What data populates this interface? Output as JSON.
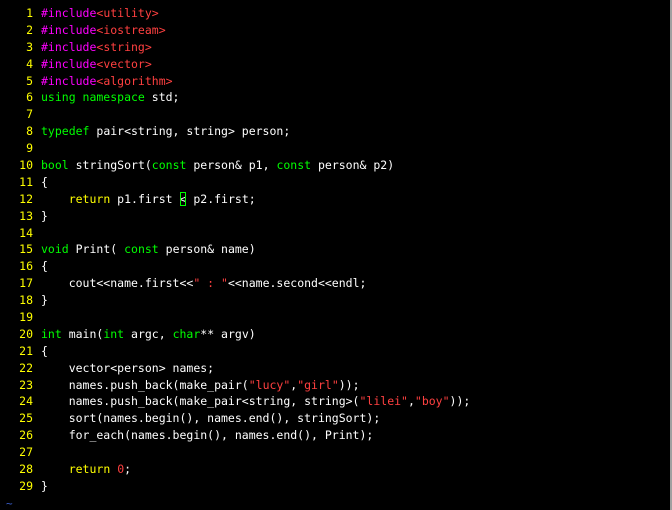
{
  "colors": {
    "background": "#000000",
    "line_number": "#ffff00",
    "plain": "#ffffff",
    "preproc": "#ff00ff",
    "string": "#ff4040",
    "keyword": "#ffff00",
    "type": "#00ff00",
    "cursor": "#00ff00",
    "tilde": "#3a5fcd"
  },
  "editor": {
    "lines": [
      {
        "n": "1",
        "tokens": [
          {
            "t": "#include",
            "c": "preproc"
          },
          {
            "t": "<utility>",
            "c": "string"
          }
        ]
      },
      {
        "n": "2",
        "tokens": [
          {
            "t": "#include",
            "c": "preproc"
          },
          {
            "t": "<iostream>",
            "c": "string"
          }
        ]
      },
      {
        "n": "3",
        "tokens": [
          {
            "t": "#include",
            "c": "preproc"
          },
          {
            "t": "<string>",
            "c": "string"
          }
        ]
      },
      {
        "n": "4",
        "tokens": [
          {
            "t": "#include",
            "c": "preproc"
          },
          {
            "t": "<vector>",
            "c": "string"
          }
        ]
      },
      {
        "n": "5",
        "tokens": [
          {
            "t": "#include",
            "c": "preproc"
          },
          {
            "t": "<algorithm>",
            "c": "string"
          }
        ]
      },
      {
        "n": "6",
        "tokens": [
          {
            "t": "using namespace",
            "c": "type"
          },
          {
            "t": " std;",
            "c": "plain"
          }
        ]
      },
      {
        "n": "7",
        "tokens": []
      },
      {
        "n": "8",
        "tokens": [
          {
            "t": "typedef",
            "c": "type"
          },
          {
            "t": " pair<string, string> person;",
            "c": "plain"
          }
        ]
      },
      {
        "n": "9",
        "tokens": []
      },
      {
        "n": "10",
        "tokens": [
          {
            "t": "bool",
            "c": "type"
          },
          {
            "t": " stringSort(",
            "c": "plain"
          },
          {
            "t": "const",
            "c": "type"
          },
          {
            "t": " person& p1, ",
            "c": "plain"
          },
          {
            "t": "const",
            "c": "type"
          },
          {
            "t": " person& p2)",
            "c": "plain"
          }
        ]
      },
      {
        "n": "11",
        "tokens": [
          {
            "t": "{",
            "c": "plain"
          }
        ]
      },
      {
        "n": "12",
        "tokens": [
          {
            "t": "    ",
            "c": "plain"
          },
          {
            "t": "return",
            "c": "keyword"
          },
          {
            "t": " p1.first ",
            "c": "plain"
          },
          {
            "t": "<",
            "c": "cursor"
          },
          {
            "t": " p2.first;",
            "c": "plain"
          }
        ]
      },
      {
        "n": "13",
        "tokens": [
          {
            "t": "}",
            "c": "plain"
          }
        ]
      },
      {
        "n": "14",
        "tokens": []
      },
      {
        "n": "15",
        "tokens": [
          {
            "t": "void",
            "c": "type"
          },
          {
            "t": " Print( ",
            "c": "plain"
          },
          {
            "t": "const",
            "c": "type"
          },
          {
            "t": " person& name)",
            "c": "plain"
          }
        ]
      },
      {
        "n": "16",
        "tokens": [
          {
            "t": "{",
            "c": "plain"
          }
        ]
      },
      {
        "n": "17",
        "tokens": [
          {
            "t": "    cout<<name.first<<",
            "c": "plain"
          },
          {
            "t": "\" : \"",
            "c": "string"
          },
          {
            "t": "<<name.second<<endl;",
            "c": "plain"
          }
        ]
      },
      {
        "n": "18",
        "tokens": [
          {
            "t": "}",
            "c": "plain"
          }
        ]
      },
      {
        "n": "19",
        "tokens": []
      },
      {
        "n": "20",
        "tokens": [
          {
            "t": "int",
            "c": "type"
          },
          {
            "t": " main(",
            "c": "plain"
          },
          {
            "t": "int",
            "c": "type"
          },
          {
            "t": " argc, ",
            "c": "plain"
          },
          {
            "t": "char",
            "c": "type"
          },
          {
            "t": "** argv)",
            "c": "plain"
          }
        ]
      },
      {
        "n": "21",
        "tokens": [
          {
            "t": "{",
            "c": "plain"
          }
        ]
      },
      {
        "n": "22",
        "tokens": [
          {
            "t": "    vector<person> names;",
            "c": "plain"
          }
        ]
      },
      {
        "n": "23",
        "tokens": [
          {
            "t": "    names.push_back(make_pair(",
            "c": "plain"
          },
          {
            "t": "\"lucy\"",
            "c": "string"
          },
          {
            "t": ",",
            "c": "plain"
          },
          {
            "t": "\"girl\"",
            "c": "string"
          },
          {
            "t": "));",
            "c": "plain"
          }
        ]
      },
      {
        "n": "24",
        "tokens": [
          {
            "t": "    names.push_back(make_pair<string, string>(",
            "c": "plain"
          },
          {
            "t": "\"lilei\"",
            "c": "string"
          },
          {
            "t": ",",
            "c": "plain"
          },
          {
            "t": "\"boy\"",
            "c": "string"
          },
          {
            "t": "));",
            "c": "plain"
          }
        ]
      },
      {
        "n": "25",
        "tokens": [
          {
            "t": "    sort(names.begin(), names.end(), stringSort);",
            "c": "plain"
          }
        ]
      },
      {
        "n": "26",
        "tokens": [
          {
            "t": "    for_each(names.begin(), names.end(), Print);",
            "c": "plain"
          }
        ]
      },
      {
        "n": "27",
        "tokens": []
      },
      {
        "n": "28",
        "tokens": [
          {
            "t": "    ",
            "c": "plain"
          },
          {
            "t": "return",
            "c": "keyword"
          },
          {
            "t": " ",
            "c": "plain"
          },
          {
            "t": "0",
            "c": "string"
          },
          {
            "t": ";",
            "c": "plain"
          }
        ]
      },
      {
        "n": "29",
        "tokens": [
          {
            "t": "}",
            "c": "plain"
          }
        ]
      }
    ],
    "tilde": "~"
  }
}
